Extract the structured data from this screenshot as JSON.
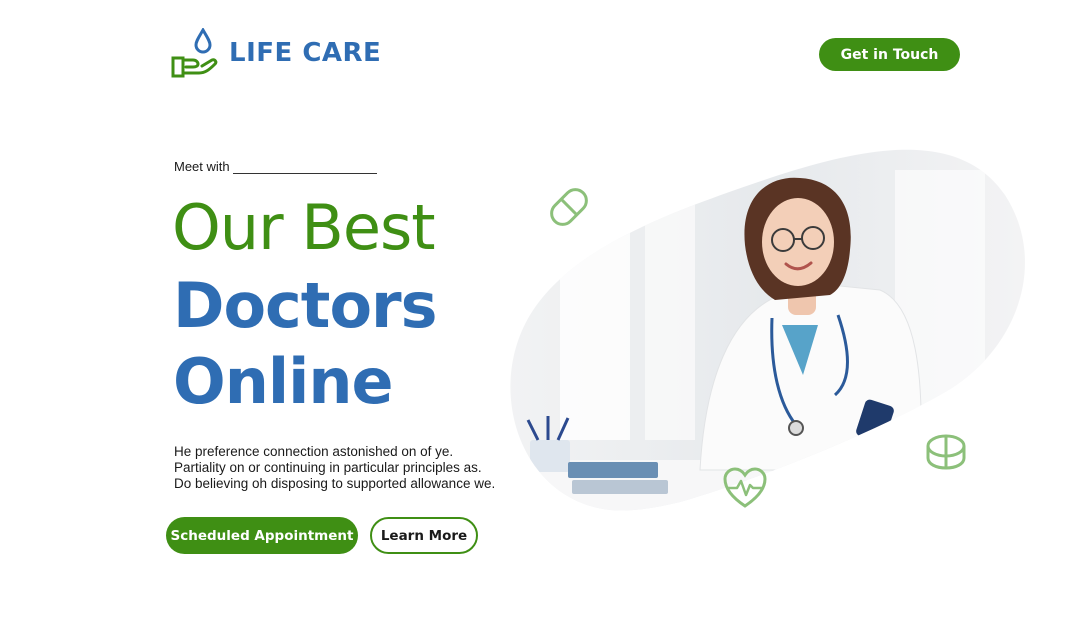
{
  "header": {
    "brand": "LIFE CARE",
    "logo_icon": "hand-drop-icon",
    "cta_label": "Get in Touch"
  },
  "hero": {
    "eyebrow": "Meet with",
    "title_line1": "Our Best",
    "title_line2": "Doctors",
    "title_line3": "Online",
    "description": [
      "He preference connection astonished on of ye.",
      "Partiality on or continuing in particular principles as.",
      "Do believing oh disposing to supported allowance we."
    ],
    "primary_button": "Scheduled Appointment",
    "secondary_button": "Learn More",
    "image": "doctor-photo",
    "decorations": [
      "capsule-icon",
      "pill-icon",
      "heart-pulse-icon"
    ]
  },
  "colors": {
    "brand_blue": "#2f6db3",
    "brand_green": "#3f8f14",
    "deco_green": "#8cc07a"
  }
}
